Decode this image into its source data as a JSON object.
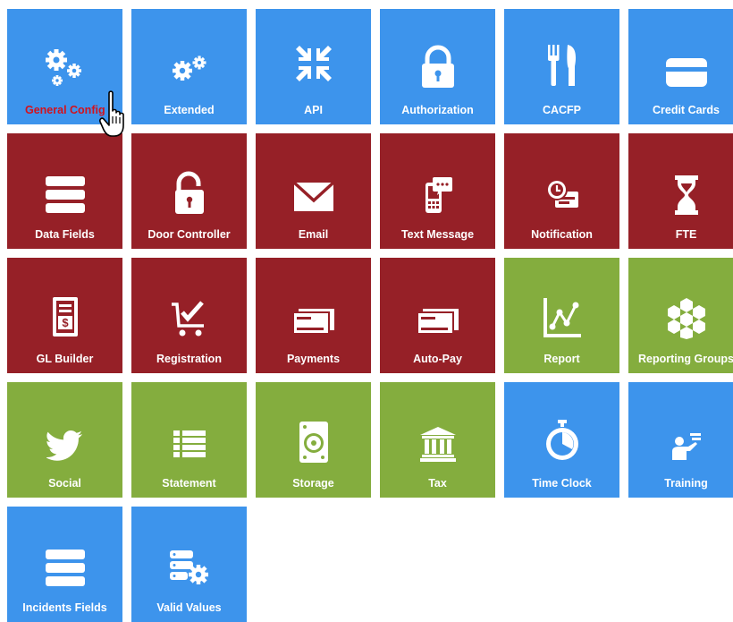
{
  "colors": {
    "blue": "#3d94ec",
    "red": "#962027",
    "green": "#84ad3e",
    "hover_label": "#d2121d"
  },
  "tiles": [
    {
      "label": "General Config",
      "color": "blue",
      "icon": "gears-icon"
    },
    {
      "label": "Extended",
      "color": "blue",
      "icon": "gears-icon"
    },
    {
      "label": "API",
      "color": "blue",
      "icon": "compress-arrows-icon"
    },
    {
      "label": "Authorization",
      "color": "blue",
      "icon": "lock-icon"
    },
    {
      "label": "CACFP",
      "color": "blue",
      "icon": "utensils-icon"
    },
    {
      "label": "Credit Cards",
      "color": "blue",
      "icon": "credit-card-icon"
    },
    {
      "label": "Data Fields",
      "color": "red",
      "icon": "stacked-bars-icon"
    },
    {
      "label": "Door Controller",
      "color": "red",
      "icon": "unlock-icon"
    },
    {
      "label": "Email",
      "color": "red",
      "icon": "envelope-icon"
    },
    {
      "label": "Text Message",
      "color": "red",
      "icon": "phone-message-icon"
    },
    {
      "label": "Notification",
      "color": "red",
      "icon": "clock-notification-icon"
    },
    {
      "label": "FTE",
      "color": "red",
      "icon": "hourglass-icon"
    },
    {
      "label": "GL Builder",
      "color": "red",
      "icon": "ledger-dollar-icon"
    },
    {
      "label": "Registration",
      "color": "red",
      "icon": "cart-check-icon"
    },
    {
      "label": "Payments",
      "color": "red",
      "icon": "check-payment-icon"
    },
    {
      "label": "Auto-Pay",
      "color": "red",
      "icon": "check-payment-icon"
    },
    {
      "label": "Report",
      "color": "green",
      "icon": "line-chart-icon"
    },
    {
      "label": "Reporting Groups",
      "color": "green",
      "icon": "hexagon-cluster-icon"
    },
    {
      "label": "Social",
      "color": "green",
      "icon": "twitter-bird-icon"
    },
    {
      "label": "Statement",
      "color": "green",
      "icon": "list-icon"
    },
    {
      "label": "Storage",
      "color": "green",
      "icon": "hard-drive-icon"
    },
    {
      "label": "Tax",
      "color": "green",
      "icon": "bank-building-icon"
    },
    {
      "label": "Time Clock",
      "color": "blue",
      "icon": "stopwatch-icon"
    },
    {
      "label": "Training",
      "color": "blue",
      "icon": "presenter-icon"
    },
    {
      "label": "Incidents Fields",
      "color": "blue",
      "icon": "stacked-bars-icon"
    },
    {
      "label": "Valid Values",
      "color": "blue",
      "icon": "database-gear-icon"
    }
  ],
  "cursor": {
    "icon": "hand-pointer-cursor-icon"
  }
}
